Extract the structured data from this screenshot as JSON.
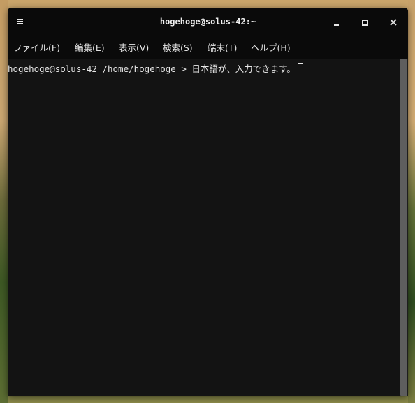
{
  "window": {
    "title": "hogehoge@solus-42:~",
    "menu_icon": "hamburger-menu-icon",
    "controls": {
      "minimize_icon": "minimize-icon",
      "maximize_icon": "maximize-icon",
      "close_icon": "close-icon"
    }
  },
  "menubar": {
    "items": [
      {
        "label": "ファイル(F)"
      },
      {
        "label": "編集(E)"
      },
      {
        "label": "表示(V)"
      },
      {
        "label": "検索(S)"
      },
      {
        "label": "端末(T)"
      },
      {
        "label": "ヘルプ(H)"
      }
    ]
  },
  "terminal": {
    "prompt": "hogehoge@solus-42 /home/hogehoge > ",
    "input_text": "日本語が、入力できます。"
  },
  "colors": {
    "terminal_bg": "#131313",
    "titlebar_bg": "#0a0a0a",
    "text": "#e6e6e6",
    "scrollbar_thumb": "#5e5e5e"
  }
}
